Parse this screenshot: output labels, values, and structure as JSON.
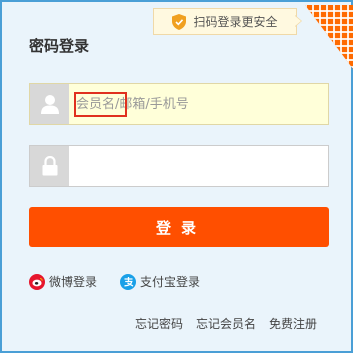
{
  "header": {
    "title": "密码登录",
    "qr_tip": "扫码登录更安全"
  },
  "form": {
    "username_placeholder": "会员名/邮箱/手机号",
    "username_value": "",
    "password_placeholder": "",
    "password_value": "",
    "submit_label": "登录"
  },
  "social": {
    "weibo_label": "微博登录",
    "alipay_label": "支付宝登录"
  },
  "links": {
    "forgot_password": "忘记密码",
    "forgot_username": "忘记会员名",
    "register": "免费注册"
  },
  "colors": {
    "accent": "#ff4f00",
    "frame_border": "#4a9fd6",
    "highlight_box": "#e0301e",
    "weibo": "#e6162d",
    "alipay": "#1aa0e8"
  },
  "icons": {
    "tip": "shield-icon",
    "qr": "qr-code-icon",
    "username": "user-icon",
    "password": "lock-icon",
    "weibo": "weibo-icon",
    "alipay": "alipay-icon"
  }
}
